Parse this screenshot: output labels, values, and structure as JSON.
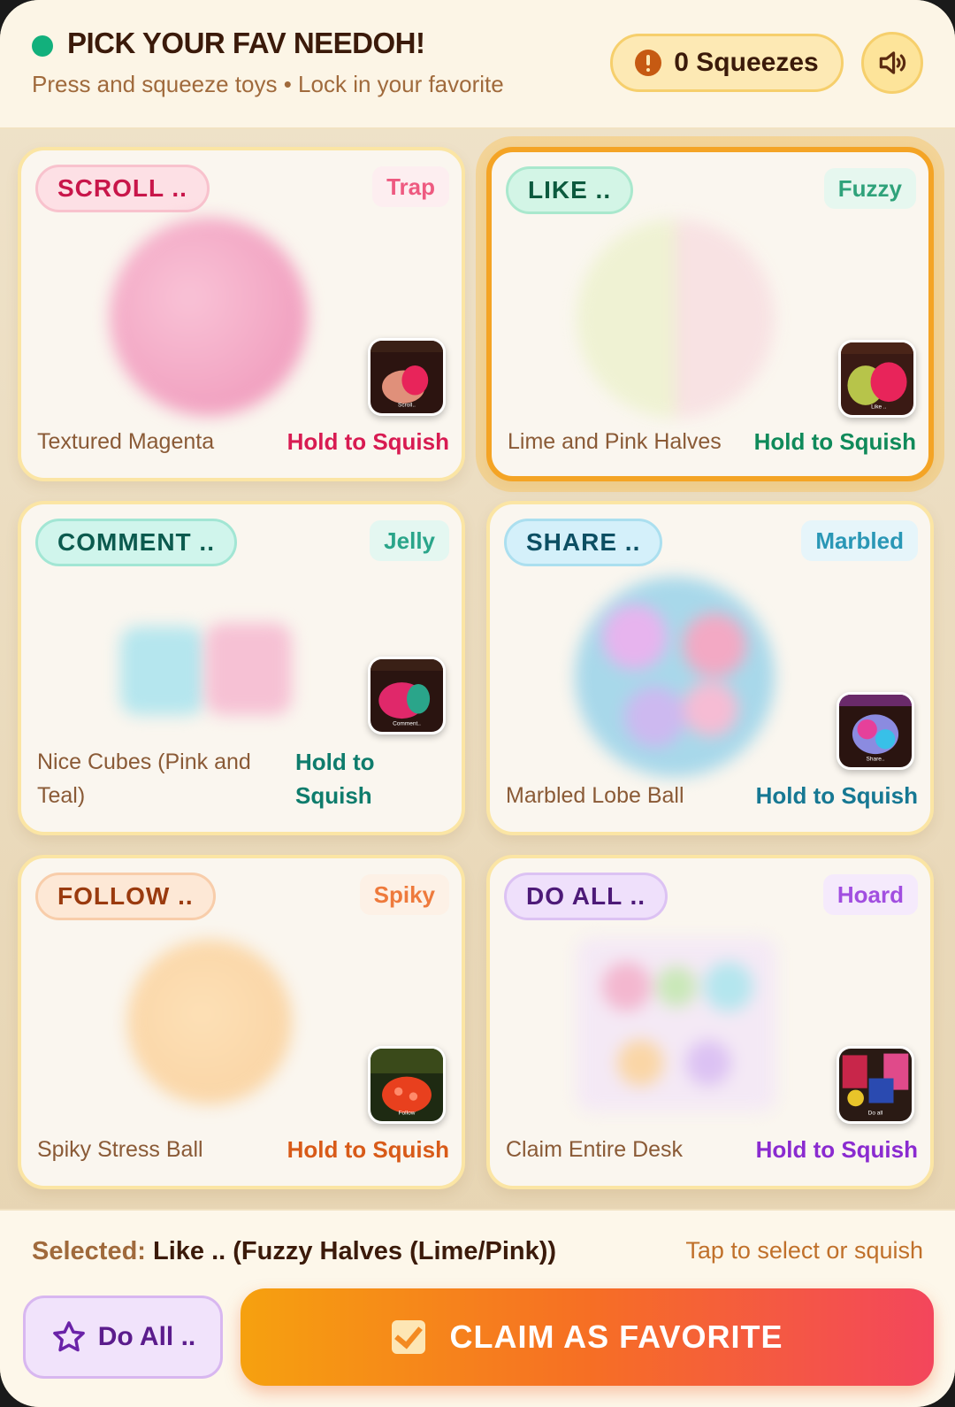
{
  "header": {
    "title": "PICK YOUR FAV NEEDOH!",
    "subtitle": "Press and squeeze toys • Lock in your favorite",
    "counter_label": "0 Squeezes",
    "counter_icon": "alert-icon",
    "sound_icon": "speaker-icon"
  },
  "cards": [
    {
      "pill": "SCROLL ..",
      "tag": "Trap",
      "name": "Textured Magenta",
      "action": "Hold to Squish",
      "thumb_caption": "Scroll..",
      "accent": "#d81b52"
    },
    {
      "pill": "LIKE ..",
      "tag": "Fuzzy",
      "name": "Lime and Pink Halves",
      "action": "Hold to Squish",
      "thumb_caption": "Like ..",
      "accent": "#0f8a5a",
      "selected": true
    },
    {
      "pill": "COMMENT ..",
      "tag": "Jelly",
      "name": "Nice Cubes (Pink and Teal)",
      "action": "Hold to Squish",
      "thumb_caption": "Comment..",
      "accent": "#0e7c6c"
    },
    {
      "pill": "SHARE ..",
      "tag": "Marbled",
      "name": "Marbled Lobe Ball",
      "action": "Hold to Squish",
      "thumb_caption": "Share..",
      "accent": "#167893"
    },
    {
      "pill": "FOLLOW ..",
      "tag": "Spiky",
      "name": "Spiky Stress Ball",
      "action": "Hold to Squish",
      "thumb_caption": "Follow",
      "accent": "#d85a18"
    },
    {
      "pill": "DO ALL ..",
      "tag": "Hoard",
      "name": "Claim Entire Desk",
      "action": "Hold to Squish",
      "thumb_caption": "Do all",
      "accent": "#8a2bd0"
    }
  ],
  "footer": {
    "selected_label": "Selected:",
    "selected_value": "Like .. (Fuzzy Halves (Lime/Pink))",
    "hint": "Tap to select or squish",
    "doall_label": "Do All ..",
    "claim_label": "CLAIM AS FAVORITE"
  }
}
